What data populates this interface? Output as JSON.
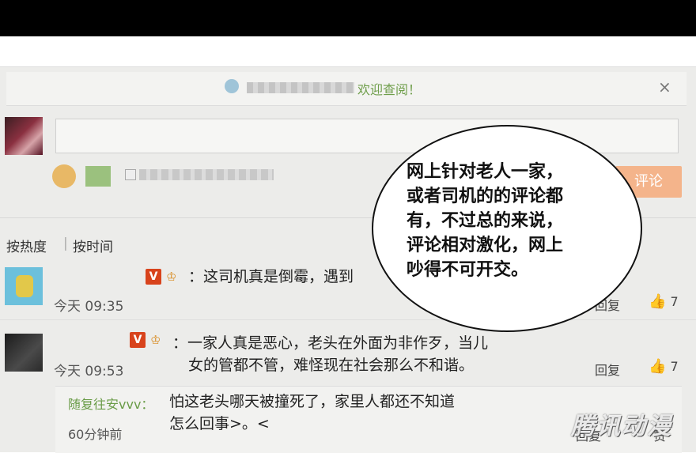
{
  "notice": {
    "text": "欢迎查阅！",
    "close": "×"
  },
  "composer": {
    "submit_label": "评论"
  },
  "sort": {
    "hot": "按热度",
    "separator": "|",
    "time": "按时间"
  },
  "comments": [
    {
      "badge": "V",
      "vip": "♔",
      "text": "：这司机真是倒霉，遇到",
      "time": "今天 09:35",
      "reply": "回复",
      "likes": "7"
    },
    {
      "badge": "V",
      "vip": "♔",
      "text_line1": "：一家人真是恶心，老头在外面为非作歹，当儿",
      "text_line2": "女的管都不管，难怪现在社会那么不和谐。",
      "time": "今天 09:53",
      "reply": "回复",
      "likes": "7"
    }
  ],
  "sub_reply": {
    "user": "随复往安vvv：",
    "text_line1": "怕这老头哪天被撞死了，家里人都还不知道",
    "text_line2": "怎么回事>。<",
    "time": "60分钟前",
    "reply": "回复",
    "like": "赞"
  },
  "speech_bubble": {
    "line1": "网上针对老人一家，",
    "line2": "或者司机的的评论都",
    "line3": "有，不过总的来说，",
    "line4": "评论相对激化，网上",
    "line5": "吵得不可开交。"
  },
  "watermark": "腾讯动漫",
  "icons": {
    "close": "close-icon",
    "emoji": "emoji-icon",
    "image": "image-icon",
    "thumb": "thumbs-up-icon",
    "vip": "crown-icon"
  },
  "colors": {
    "submit": "#f4b48b",
    "notice_text": "#6f9e4b",
    "badge": "#d8431c"
  }
}
